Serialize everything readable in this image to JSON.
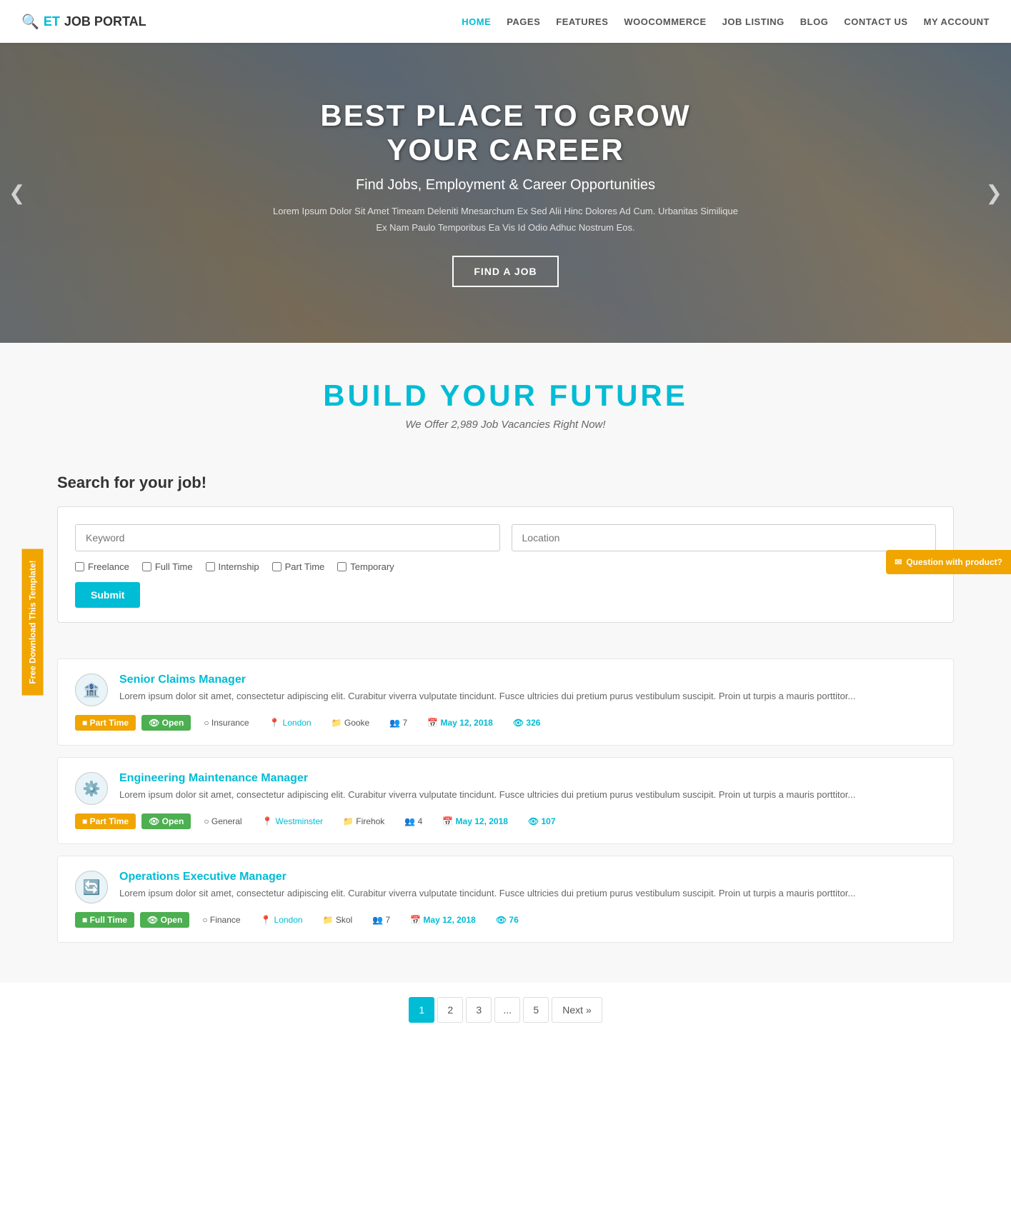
{
  "nav": {
    "logo": {
      "icon": "🔍",
      "et": "ET",
      "rest": " JOB PORTAL"
    },
    "links": [
      {
        "label": "HOME",
        "active": true
      },
      {
        "label": "PAGES",
        "active": false
      },
      {
        "label": "FEATURES",
        "active": false
      },
      {
        "label": "WOOCOMMERCE",
        "active": false
      },
      {
        "label": "JOB LISTING",
        "active": false
      },
      {
        "label": "BLOG",
        "active": false
      },
      {
        "label": "CONTACT US",
        "active": false
      },
      {
        "label": "MY ACCOUNT",
        "active": false
      }
    ]
  },
  "hero": {
    "title": "BEST PLACE TO GROW YOUR CAREER",
    "subtitle": "Find Jobs, Employment & Career Opportunities",
    "description": "Lorem Ipsum Dolor Sit Amet Timeam Deleniti Mnesarchum Ex Sed Alii Hinc Dolores Ad Cum. Urbanitas Similique Ex Nam Paulo Temporibus Ea Vis Id Odio Adhuc Nostrum Eos.",
    "cta": "FIND A JOB"
  },
  "floats": {
    "left_label": "Free Download This Template!",
    "right_icon": "✉",
    "right_label": "Question with product?"
  },
  "build": {
    "title": "BUILD YOUR FUTURE",
    "subtitle": "We Offer 2,989 Job Vacancies Right Now!"
  },
  "search": {
    "heading": "Search for your job!",
    "keyword_placeholder": "Keyword",
    "location_placeholder": "Location",
    "filters": [
      {
        "id": "freelance",
        "label": "Freelance"
      },
      {
        "id": "fulltime",
        "label": "Full Time"
      },
      {
        "id": "internship",
        "label": "Internship"
      },
      {
        "id": "parttime",
        "label": "Part Time"
      },
      {
        "id": "temporary",
        "label": "Temporary"
      }
    ],
    "submit_label": "Submit"
  },
  "jobs": [
    {
      "id": 1,
      "logo_emoji": "🏦",
      "title": "Senior Claims Manager",
      "description": "Lorem ipsum dolor sit amet, consectetur adipiscing elit. Curabitur viverra vulputate tincidunt. Fusce ultricies dui pretium purus vestibulum suscipit. Proin ut turpis a mauris porttitor...",
      "type": "Part Time",
      "type_class": "tag-parttime",
      "status": "Open",
      "category": "Insurance",
      "location": "London",
      "company": "Gooke",
      "applicants": "7",
      "date": "May 12, 2018",
      "views": "326"
    },
    {
      "id": 2,
      "logo_emoji": "⚙️",
      "title": "Engineering Maintenance Manager",
      "description": "Lorem ipsum dolor sit amet, consectetur adipiscing elit. Curabitur viverra vulputate tincidunt. Fusce ultricies dui pretium purus vestibulum suscipit. Proin ut turpis a mauris porttitor...",
      "type": "Part Time",
      "type_class": "tag-parttime",
      "status": "Open",
      "category": "General",
      "location": "Westminster",
      "company": "Firehok",
      "applicants": "4",
      "date": "May 12, 2018",
      "views": "107"
    },
    {
      "id": 3,
      "logo_emoji": "🔄",
      "title": "Operations Executive Manager",
      "description": "Lorem ipsum dolor sit amet, consectetur adipiscing elit. Curabitur viverra vulputate tincidunt. Fusce ultricies dui pretium purus vestibulum suscipit. Proin ut turpis a mauris porttitor...",
      "type": "Full Time",
      "type_class": "tag-fulltime",
      "status": "Open",
      "category": "Finance",
      "location": "London",
      "company": "Skol",
      "applicants": "7",
      "date": "May 12, 2018",
      "views": "76"
    }
  ],
  "pagination": {
    "pages": [
      "1",
      "2",
      "3",
      "...",
      "5"
    ],
    "next_label": "Next »"
  }
}
